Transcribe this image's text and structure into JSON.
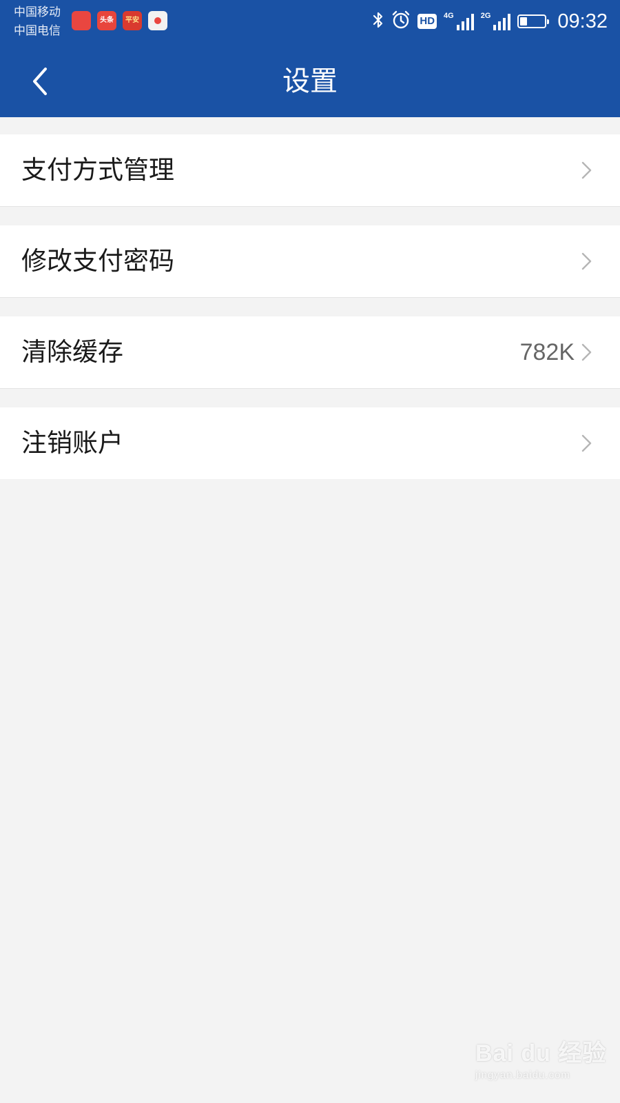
{
  "colors": {
    "brand": "#1a52a5",
    "background": "#f3f3f3",
    "row_background": "#ffffff",
    "chevron": "#b5b5b5",
    "value_text": "#666666"
  },
  "status_bar": {
    "carrier_1": "中国移动",
    "carrier_2": "中国电信",
    "time": "09:32",
    "hd_label": "HD",
    "network_1": "4G",
    "network_2": "2G",
    "battery_level": 0.3,
    "app_icons": [
      {
        "icon": "app-icon-red",
        "label": ""
      },
      {
        "icon": "toutiao-app-icon",
        "label": "头条"
      },
      {
        "icon": "pingan-app-icon",
        "label": "平安"
      },
      {
        "icon": "map-app-icon",
        "label": ""
      }
    ],
    "status_icons": [
      "bluetooth-icon",
      "alarm-icon",
      "hd-icon",
      "signal-icon",
      "signal-icon",
      "battery-icon"
    ]
  },
  "header": {
    "back_icon": "chevron-left-icon",
    "title": "设置"
  },
  "settings": {
    "items": [
      {
        "label": "支付方式管理",
        "value": "",
        "icon": "chevron-right-icon"
      },
      {
        "label": "修改支付密码",
        "value": "",
        "icon": "chevron-right-icon"
      },
      {
        "label": "清除缓存",
        "value": "782K",
        "icon": "chevron-right-icon"
      },
      {
        "label": "注销账户",
        "value": "",
        "icon": "chevron-right-icon"
      }
    ]
  },
  "watermark": {
    "main": "Bai du 经验",
    "sub": "jingyan.baidu.com"
  }
}
